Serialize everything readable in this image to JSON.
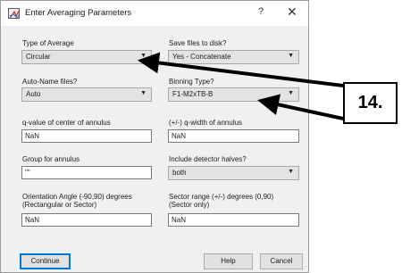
{
  "window": {
    "title": "Enter Averaging Parameters",
    "help_label": "?",
    "close_label": "✕"
  },
  "fields": {
    "type_of_average": {
      "label": "Type of Average",
      "value": "Circular"
    },
    "save_files": {
      "label": "Save files to disk?",
      "value": "Yes - Concatenate"
    },
    "auto_name": {
      "label": "Auto-Name files?",
      "value": "Auto"
    },
    "binning_type": {
      "label": "Binning Type?",
      "value": "F1-M2xTB-B"
    },
    "q_center": {
      "label": "q-value of center of annulus",
      "value": "NaN"
    },
    "q_width": {
      "label": "(+/-) q-width of annulus",
      "value": "NaN"
    },
    "group_annulus": {
      "label": "Group for annulus",
      "value": "\"\""
    },
    "detector_halves": {
      "label": "Include detector halves?",
      "value": "both"
    },
    "orientation": {
      "label_line1": "Orientation Angle (-90,90) degrees",
      "label_line2": "(Rectangular or Sector)",
      "value": "NaN"
    },
    "sector_range": {
      "label_line1": "Sector range (+/-) degrees (0,90)",
      "label_line2": "(Sector only)",
      "value": "NaN"
    }
  },
  "buttons": {
    "continue": "Continue",
    "help": "Help",
    "cancel": "Cancel"
  },
  "annotation": {
    "label": "14."
  },
  "icons": {
    "dropdown": "chevron-down-icon",
    "app": "app-icon",
    "resize": "resize-grip-icon"
  },
  "dropdown_arrow": "▼",
  "grip_glyph": "⋰"
}
